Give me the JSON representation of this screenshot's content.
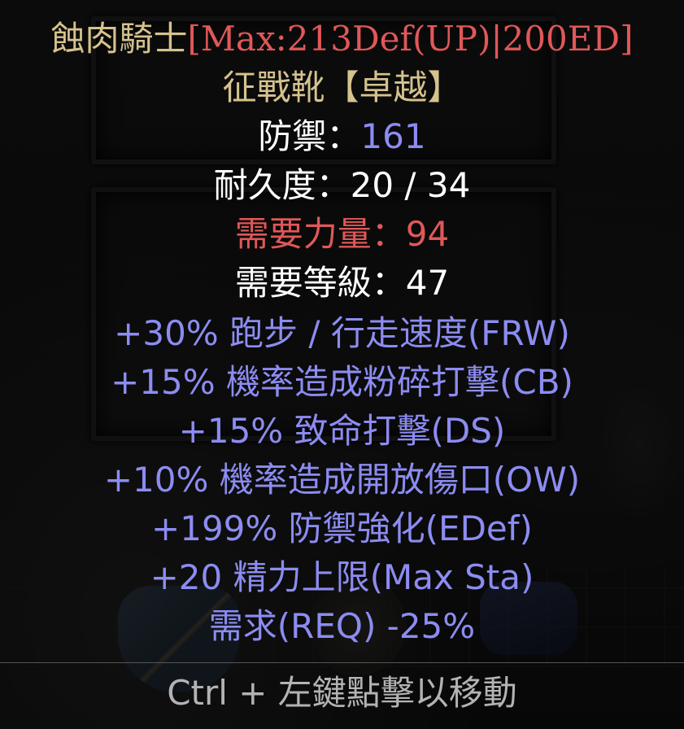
{
  "item": {
    "name": "蝕肉騎士",
    "tag": "[Max:213Def(UP)|200ED]",
    "base": "征戰靴【卓越】",
    "defense_label": "防禦：",
    "defense_value": "161",
    "durability": "耐久度：20 / 34",
    "req_str": "需要力量：94",
    "req_level": "需要等級：47",
    "mods": [
      "+30% 跑步 / 行走速度(FRW)",
      "+15% 機率造成粉碎打擊(CB)",
      "+15% 致命打擊(DS)",
      "+10% 機率造成開放傷口(OW)",
      "+199% 防禦強化(EDef)",
      "+20 精力上限(Max Sta)",
      "需求(REQ) -25%"
    ]
  },
  "hint": "Ctrl + 左鍵點擊以移動",
  "colors": {
    "unique_gold": "#d5c28e",
    "requirement_red": "#e05858",
    "magic_blue": "#8c8cf2",
    "text_white": "#ffffff",
    "hint_gray": "#b3b3b3"
  },
  "icons": [
    "shield-icon",
    "orb-icon",
    "glove-icon"
  ]
}
